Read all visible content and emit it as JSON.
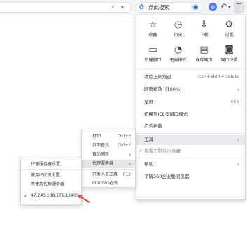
{
  "browser": {
    "search_text": "点此搜索",
    "address_icons": [
      "bolt-icon",
      "chevron-down-icon"
    ],
    "search_icons": [
      "search-logo-icon",
      "search-question-icon"
    ]
  },
  "menu": {
    "icon_row1": [
      {
        "label": "收藏",
        "icon": "star-icon",
        "glyph": "☆"
      },
      {
        "label": "历史",
        "icon": "clock-icon",
        "glyph": "◷"
      },
      {
        "label": "下载",
        "icon": "download-icon",
        "glyph": "⇩"
      },
      {
        "label": "设置",
        "icon": "gear-icon",
        "glyph": "⚙"
      }
    ],
    "icon_row2": [
      {
        "label": "新建窗口",
        "icon": "new-window-icon",
        "glyph": "▭"
      },
      {
        "label": "无痕模式",
        "icon": "incognito-icon",
        "glyph": "◔"
      },
      {
        "label": "保存网页",
        "icon": "save-icon",
        "glyph": "▤"
      },
      {
        "label": "网页快照",
        "icon": "camera-icon",
        "glyph": "◙"
      }
    ],
    "items": [
      {
        "label": "清除上网痕迹",
        "shortcut": "Ctrl+Shift+Delete"
      },
      {
        "label": "网页缩放（100%）",
        "arrow": "›"
      },
      {
        "label": "全屏",
        "shortcut": "F11"
      },
      {
        "label": "切换到IE8多窗口模式"
      },
      {
        "label": "广告拦截"
      },
      {
        "label": "工具",
        "arrow": "›"
      },
      {
        "label": "设置为默认浏览器",
        "check": "✓"
      },
      {
        "label": "帮助",
        "arrow": "›"
      },
      {
        "label": "了解360企业版浏览器"
      }
    ]
  },
  "tools_submenu": {
    "items": [
      {
        "label": "打印",
        "shortcut": "Ctrl+P"
      },
      {
        "label": "页面查找",
        "shortcut": "Ctrl+F"
      },
      {
        "label": "自动刷新",
        "arrow": "›"
      },
      {
        "label": "代理服务器",
        "arrow": "›"
      },
      {
        "label": "开发人员工具",
        "shortcut": "F12"
      },
      {
        "label": "Internet选项"
      }
    ]
  },
  "proxy_submenu": {
    "items": [
      {
        "label": "代理服务器设置"
      },
      {
        "label": "使用IE代理设置"
      },
      {
        "label": "不使用代理服务器"
      },
      {
        "label": "47.240.108.171:12405",
        "check": "✓"
      }
    ]
  },
  "annotation": {
    "arrow_color": "#e23b3b"
  }
}
